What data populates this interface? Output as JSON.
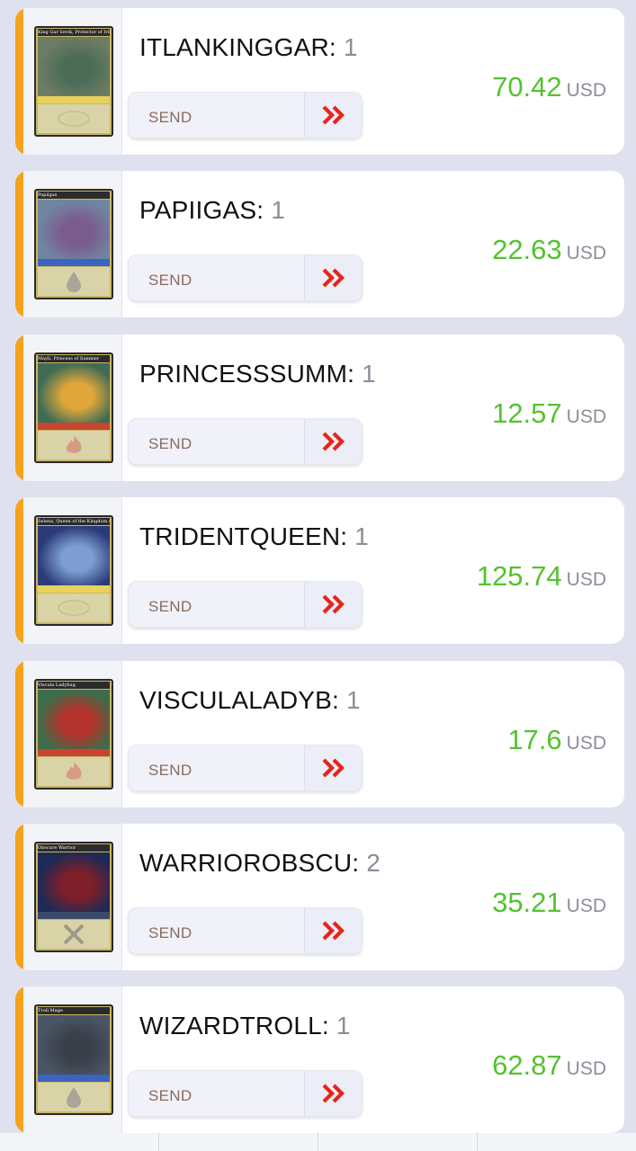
{
  "items": [
    {
      "name": "ITLANKINGGAR",
      "separator": ": ",
      "qty": "1",
      "price": "70.42",
      "currency": "USD",
      "send_label": "SEND",
      "art": {
        "title": "King Gar Sevik, Protector of Irlin",
        "sky": "#6d7d63",
        "figure": "#4c6c58",
        "bar": "#e9d25c",
        "element": "earth-icon"
      }
    },
    {
      "name": "PAPIIGAS",
      "separator": ": ",
      "qty": "1",
      "price": "22.63",
      "currency": "USD",
      "send_label": "SEND",
      "art": {
        "title": "Papiigas",
        "sky": "#6f86a3",
        "figure": "#7b5c8e",
        "bar": "#3b63c0",
        "element": "water-icon"
      }
    },
    {
      "name": "PRINCESSSUMM",
      "separator": ": ",
      "qty": "1",
      "price": "12.57",
      "currency": "USD",
      "send_label": "SEND",
      "art": {
        "title": "Mayli, Princess of Summer",
        "sky": "#3f6c55",
        "figure": "#e0a63a",
        "bar": "#c9442e",
        "element": "fire-icon"
      }
    },
    {
      "name": "TRIDENTQUEEN",
      "separator": ": ",
      "qty": "1",
      "price": "125.74",
      "currency": "USD",
      "send_label": "SEND",
      "art": {
        "title": "Selena, Queen of the Kingdom of Tridens",
        "sky": "#2b3b7a",
        "figure": "#7c9ed0",
        "bar": "#e9d25c",
        "element": "earth-icon"
      }
    },
    {
      "name": "VISCULALADYB",
      "separator": ": ",
      "qty": "1",
      "price": "17.6",
      "currency": "USD",
      "send_label": "SEND",
      "art": {
        "title": "Viscula Ladybug",
        "sky": "#3c6d4a",
        "figure": "#b3322b",
        "bar": "#c9442e",
        "element": "fire-icon"
      }
    },
    {
      "name": "WARRIOROBSCU",
      "separator": ": ",
      "qty": "2",
      "price": "35.21",
      "currency": "USD",
      "send_label": "SEND",
      "art": {
        "title": "Obscure Warrior",
        "sky": "#1d2a55",
        "figure": "#7e1f2a",
        "bar": "#3a4a6a",
        "element": "death-icon"
      }
    },
    {
      "name": "WIZARDTROLL",
      "separator": ": ",
      "qty": "1",
      "price": "62.87",
      "currency": "USD",
      "send_label": "SEND",
      "art": {
        "title": "Troll Mage",
        "sky": "#4a5566",
        "figure": "#3b3f49",
        "bar": "#3b63c0",
        "element": "water-icon"
      }
    }
  ],
  "colors": {
    "accent": "#f5a31c",
    "price": "#54c22f",
    "send_arrow": "#e8231b",
    "send_text": "#8a6b5d"
  }
}
